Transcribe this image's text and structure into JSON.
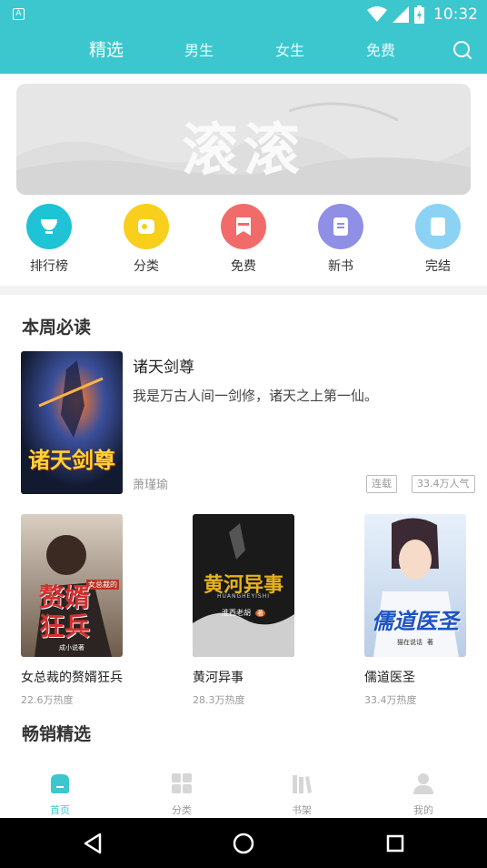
{
  "status": {
    "time": "10:32",
    "app_badge": "A"
  },
  "topnav": {
    "tabs": [
      "精选",
      "男生",
      "女生",
      "免费"
    ]
  },
  "banner": {
    "title": "滚滚"
  },
  "entries": [
    {
      "label": "排行榜",
      "color": "#1fc3d6",
      "icon": "trophy-icon"
    },
    {
      "label": "分类",
      "color": "#f7cf1c",
      "icon": "category-icon"
    },
    {
      "label": "免费",
      "color": "#f26b6b",
      "icon": "free-icon"
    },
    {
      "label": "新书",
      "color": "#8f8fe6",
      "icon": "newbook-icon"
    },
    {
      "label": "完结",
      "color": "#8cd2f5",
      "icon": "finished-icon"
    }
  ],
  "weekly": {
    "title": "本周必读",
    "featured": {
      "title": "诸天剑尊",
      "desc": "我是万古人间一剑修，诸天之上第一仙。",
      "author": "萧瑾瑜",
      "status": "连载",
      "popularity": "33.4万人气",
      "cover_text": "诸天剑尊"
    },
    "books": [
      {
        "title": "女总裁的赘婿狂兵",
        "heat": "22.6万热度",
        "cover_text": "赘婿狂兵",
        "cover_subtext": "成小说著",
        "cover_badge": "女总裁的"
      },
      {
        "title": "黄河异事",
        "heat": "28.3万热度",
        "cover_text": "黄河异事",
        "cover_subtext": "HUANGHEYISHI",
        "cover_author": "淮西老胡",
        "cover_badge": "著"
      },
      {
        "title": "儒道医圣",
        "heat": "33.4万热度",
        "cover_text": "儒道医圣",
        "cover_subtext": "猫在说话",
        "cover_badge": "著"
      }
    ]
  },
  "bestseller": {
    "title": "畅销精选"
  },
  "tabbar": [
    {
      "label": "首页",
      "active": true
    },
    {
      "label": "分类",
      "active": false
    },
    {
      "label": "书架",
      "active": false
    },
    {
      "label": "我的",
      "active": false
    }
  ],
  "colors": {
    "accent": "#3cc7cf",
    "text": "#333333",
    "muted": "#999999"
  }
}
